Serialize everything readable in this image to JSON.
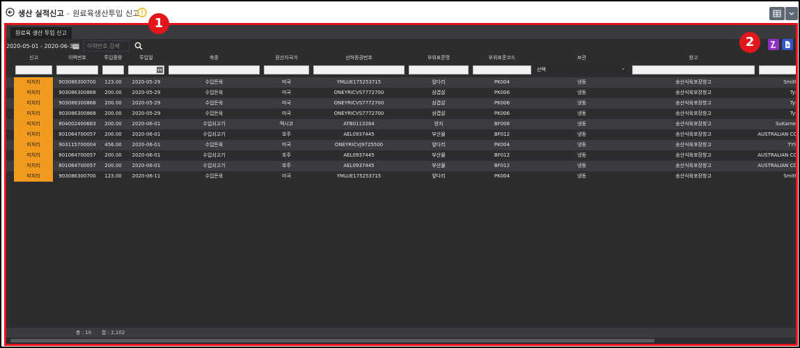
{
  "title": {
    "main": "생산 실적신고",
    "separator": "-",
    "sub": "원료육생산투입 신고"
  },
  "tab": {
    "label": "원료육 생산 투입 신고"
  },
  "toolbar": {
    "date_range": "2020-05-01 - 2020-06-30",
    "search_placeholder": "이력번호 검색"
  },
  "columns": [
    "신고",
    "이력번호",
    "투입중량",
    "투입일",
    "축종",
    "원산지국가",
    "선하증권번호",
    "부위표준명",
    "부위표준코드",
    "보관",
    "창고",
    ""
  ],
  "filter": {
    "storage_select": "선택",
    "storage_chevron": "⌄"
  },
  "rows": [
    [
      "미처리",
      "903086300700",
      "123.00",
      "2020-05-29",
      "수입돈육",
      "미국",
      "YMLUE175253715",
      "앞다리",
      "PK004",
      "냉동",
      "송산식육포장창고",
      "Smithfi"
    ],
    [
      "미처리",
      "903086300868",
      "200.00",
      "2020-05-29",
      "수입돈육",
      "미국",
      "ONEYRICVS7772700",
      "삼겹살",
      "PK006",
      "냉동",
      "송산식육포장창고",
      "Tyso"
    ],
    [
      "미처리",
      "903086300868",
      "200.00",
      "2020-05-29",
      "수입돈육",
      "미국",
      "ONEYRICVS7772700",
      "삼겹살",
      "PK006",
      "냉동",
      "송산식육포장창고",
      "Tyso"
    ],
    [
      "미처리",
      "903086300868",
      "200.00",
      "2020-05-29",
      "수입돈육",
      "미국",
      "ONEYRICVS7772700",
      "삼겹살",
      "PK006",
      "냉동",
      "송산식육포장창고",
      "Tyso"
    ],
    [
      "미처리",
      "804002400683",
      "200.00",
      "2020-06-01",
      "수입쇠고기",
      "멕시코",
      "ATB0113264",
      "양지",
      "BF008",
      "냉동",
      "송산식육포장창고",
      "SuKarne A"
    ],
    [
      "미처리",
      "801064700057",
      "200.00",
      "2020-06-01",
      "수입쇠고기",
      "호주",
      "AEL0937445",
      "부산물",
      "BF012",
      "냉동",
      "송산식육포장창고",
      "AUSTRALIAN COU"
    ],
    [
      "미처리",
      "903115700004",
      "456.00",
      "2020-06-01",
      "수입돈육",
      "미국",
      "ONEYRICVJ9725500",
      "앞다리",
      "PK004",
      "냉동",
      "송산식육포장창고",
      "TYSO"
    ],
    [
      "미처리",
      "801064700057",
      "200.00",
      "2020-06-01",
      "수입쇠고기",
      "호주",
      "AEL0937445",
      "부산물",
      "BF012",
      "냉동",
      "송산식육포장창고",
      "AUSTRALIAN COU"
    ],
    [
      "미처리",
      "801064700057",
      "200.00",
      "2020-06-01",
      "수입쇠고기",
      "호주",
      "AEL0937445",
      "부산물",
      "BF012",
      "냉동",
      "송산식육포장창고",
      "AUSTRALIAN COU"
    ],
    [
      "미처리",
      "903086300700",
      "123.00",
      "2020-06-11",
      "수입돈육",
      "미국",
      "YMLUE175253715",
      "앞다리",
      "PK004",
      "냉동",
      "송산식육포장창고",
      "Smithfi"
    ]
  ],
  "footer": {
    "count": "총 : 10",
    "sum": "합 : 2,102"
  },
  "callouts": [
    "1",
    "2"
  ],
  "colors": {
    "status": "#f29a1d",
    "frame": "#e3161c",
    "btn_purple": "#8e2fc4",
    "btn_blue": "#3358c9"
  }
}
